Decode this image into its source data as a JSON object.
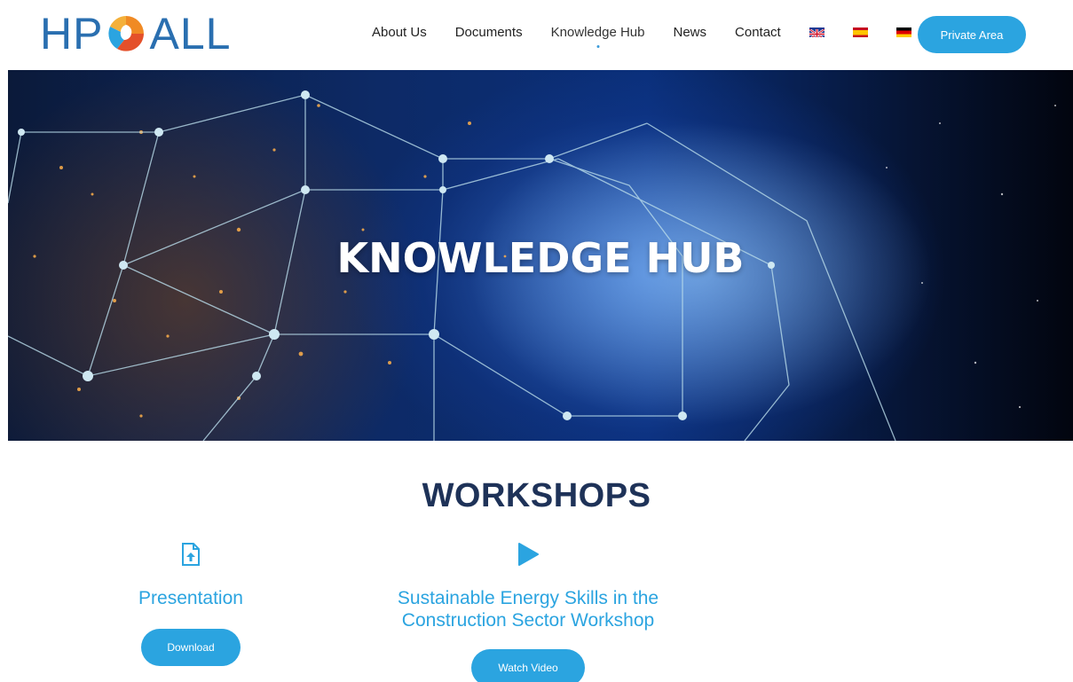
{
  "brand": {
    "logo_text_left": "HP",
    "logo_text_right": "ALL",
    "logo_icon": "hp4all-swirl-logo",
    "primary_color": "#2ba4e0",
    "logo_color": "#2a6fb0"
  },
  "nav": {
    "items": [
      {
        "label": "About Us"
      },
      {
        "label": "Documents"
      },
      {
        "label": "Knowledge Hub",
        "active": true
      },
      {
        "label": "News"
      },
      {
        "label": "Contact"
      }
    ],
    "languages": [
      {
        "icon": "uk-flag-icon"
      },
      {
        "icon": "spain-flag-icon"
      },
      {
        "icon": "germany-flag-icon"
      }
    ],
    "private_area_label": "Private Area"
  },
  "hero": {
    "title": "KNOWLEDGE HUB"
  },
  "workshops": {
    "title": "WORKSHOPS",
    "items": [
      {
        "icon": "file-upload-icon",
        "title": "Presentation",
        "button_label": "Download"
      },
      {
        "icon": "play-icon",
        "title": "Sustainable Energy Skills in the Construction Sector Workshop",
        "button_label": "Watch Video"
      }
    ]
  }
}
